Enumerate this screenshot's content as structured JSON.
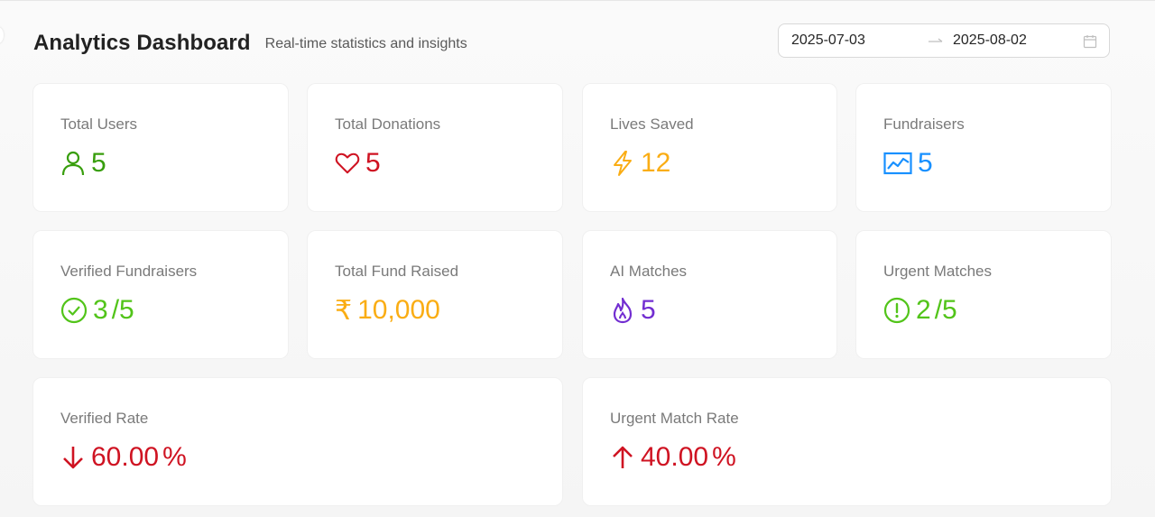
{
  "header": {
    "title": "Analytics Dashboard",
    "subtitle": "Real-time statistics and insights"
  },
  "date_range": {
    "start": "2025-07-03",
    "end": "2025-08-02",
    "separator_icon": "arrow-right-icon",
    "calendar_icon": "calendar-icon"
  },
  "colors": {
    "green": "#389e0d",
    "red": "#cf1322",
    "orange": "#faad14",
    "blue": "#1890ff",
    "lime": "#52c41a",
    "purple": "#722ed1"
  },
  "stats": [
    {
      "label": "Total Users",
      "value": "5",
      "icon": "user-icon",
      "color": "#389e0d"
    },
    {
      "label": "Total Donations",
      "value": "5",
      "icon": "heart-icon",
      "color": "#cf1322"
    },
    {
      "label": "Lives Saved",
      "value": "12",
      "icon": "thunderbolt-icon",
      "color": "#faad14"
    },
    {
      "label": "Fundraisers",
      "value": "5",
      "icon": "line-chart-icon",
      "color": "#1890ff"
    },
    {
      "label": "Verified Fundraisers",
      "value": "3",
      "suffix": "/5",
      "icon": "check-circle-icon",
      "color": "#52c41a"
    },
    {
      "label": "Total Fund Raised",
      "prefix": "₹",
      "value": "10,000",
      "color": "#faad14"
    },
    {
      "label": "AI Matches",
      "value": "5",
      "icon": "fire-icon",
      "color": "#722ed1"
    },
    {
      "label": "Urgent Matches",
      "value": "2",
      "suffix": "/5",
      "icon": "exclamation-circle-icon",
      "color": "#52c41a"
    },
    {
      "label": "Verified Rate",
      "value": "60.00",
      "suffix": "%",
      "icon": "arrow-down-icon",
      "color": "#cf1322"
    },
    {
      "label": "Urgent Match Rate",
      "value": "40.00",
      "suffix": "%",
      "icon": "arrow-up-icon",
      "color": "#cf1322"
    }
  ]
}
